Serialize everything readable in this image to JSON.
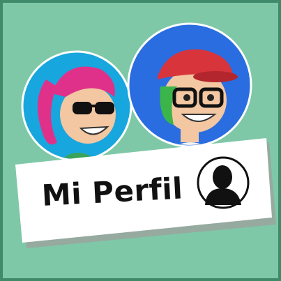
{
  "card": {
    "title": "Mi Perfil"
  },
  "icons": {
    "avatar": "user-silhouette-icon",
    "left": "girl-avatar-icon",
    "right": "boy-avatar-icon"
  },
  "colors": {
    "background": "#7ec8a8",
    "border": "#3f8a6a",
    "left_circle": "#17a6de",
    "right_circle": "#2a6de0",
    "card": "#ffffff"
  }
}
